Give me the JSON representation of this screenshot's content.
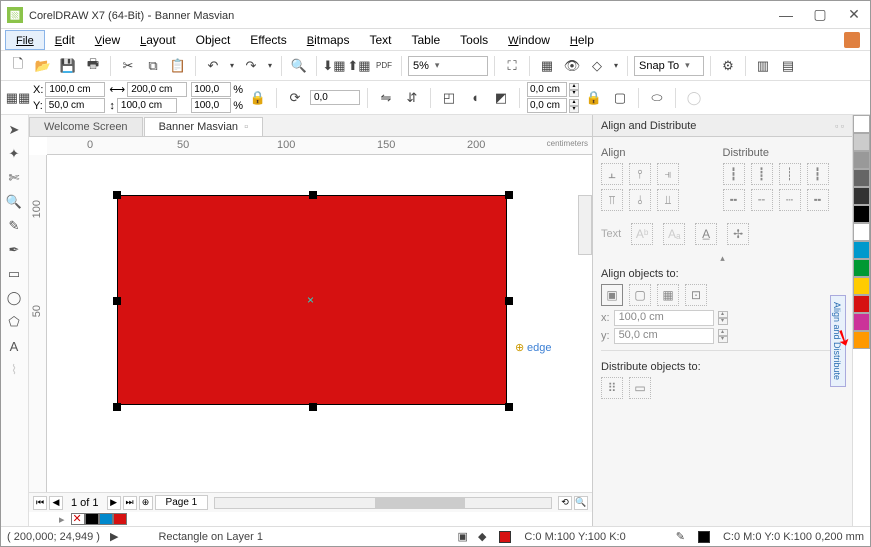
{
  "app": {
    "name": "CorelDRAW X7 (64-Bit)",
    "doc": "Banner Masvian"
  },
  "menu": [
    "File",
    "Edit",
    "View",
    "Layout",
    "Object",
    "Effects",
    "Bitmaps",
    "Text",
    "Table",
    "Tools",
    "Window",
    "Help"
  ],
  "toolbar": {
    "zoom": "5%",
    "snap": "Snap To"
  },
  "props": {
    "x": "100,0 cm",
    "y": "50,0 cm",
    "w": "200,0 cm",
    "h": "100,0 cm",
    "sx": "100,0",
    "sy": "100,0",
    "rot": "0,0",
    "ox": "0,0 cm",
    "oy": "0,0 cm"
  },
  "tabs": {
    "t1": "Welcome Screen",
    "t2": "Banner Masvian"
  },
  "ruler": {
    "u": "centimeters",
    "m0": "0",
    "m50": "50",
    "m100": "100",
    "m150": "150",
    "m200": "200",
    "v100": "100",
    "v50": "50"
  },
  "canvas": {
    "edge": "edge"
  },
  "pager": {
    "of": "1 of 1",
    "page": "Page 1"
  },
  "dock": {
    "title": "Align and Distribute",
    "align": "Align",
    "dist": "Distribute",
    "text": "Text",
    "alignto": "Align objects to:",
    "distto": "Distribute objects to:",
    "xlbl": "x:",
    "ylbl": "y:",
    "xv": "100,0 cm",
    "yv": "50,0 cm",
    "vtab": "Align and Distribute"
  },
  "status": {
    "coords": "( 200,000; 24,949 )",
    "obj": "Rectangle on Layer 1",
    "fill": "C:0 M:100 Y:100 K:0",
    "outline": "C:0 M:0 Y:0 K:100  0,200 mm"
  },
  "palette": [
    "#ffffff",
    "#cccccc",
    "#999999",
    "#666666",
    "#333333",
    "#000000",
    "#ffffff",
    "#0099cc",
    "#009933",
    "#ffcc00",
    "#d61111",
    "#cc3399",
    "#ff9900"
  ]
}
